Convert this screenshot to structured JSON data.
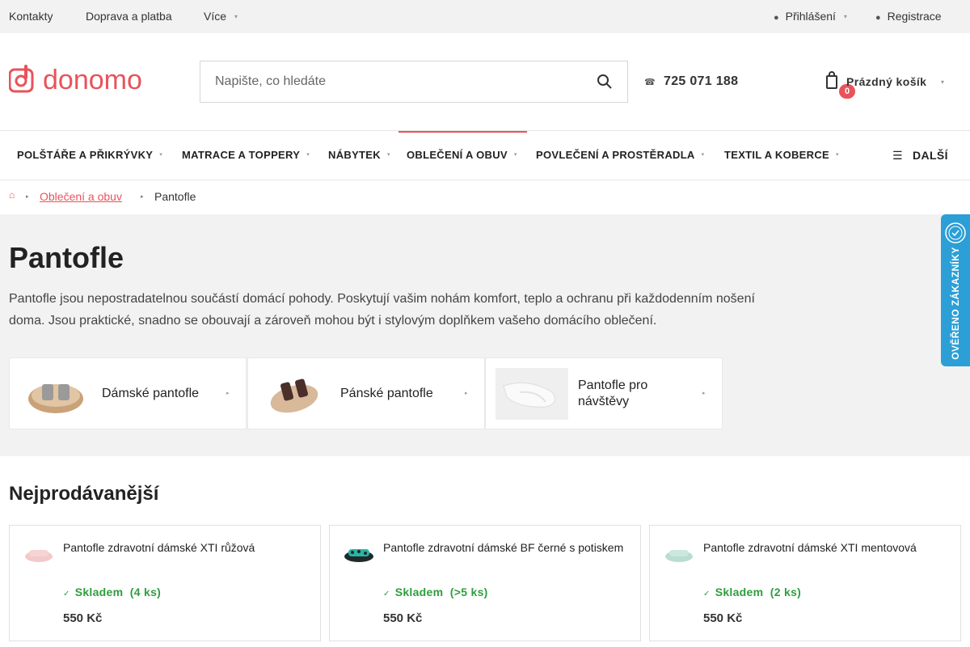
{
  "topbar": {
    "links": [
      "Kontakty",
      "Doprava a platba",
      "Více"
    ],
    "login": "Přihlášení",
    "register": "Registrace"
  },
  "header": {
    "logo_text": "donomo",
    "search_placeholder": "Napište, co hledáte",
    "phone": "725 071 188",
    "cart_label": "Prázdný košík",
    "cart_count": "0"
  },
  "nav": {
    "items": [
      "POLŠTÁŘE A PŘIKRÝVKY",
      "MATRACE A TOPPERY",
      "NÁBYTEK",
      "OBLEČENÍ A OBUV",
      "POVLEČENÍ A PROSTĚRADLA",
      "TEXTIL A KOBERCE"
    ],
    "active_index": 3,
    "more": "DALŠÍ"
  },
  "breadcrumb": {
    "parent": "Oblečení a obuv",
    "current": "Pantofle"
  },
  "category": {
    "title": "Pantofle",
    "description": "Pantofle jsou nepostradatelnou součástí domácí pohody. Poskytují vašim nohám komfort, teplo a ochranu při každodenním nošení doma. Jsou praktické, snadno se obouvají a zároveň mohou být i stylovým doplňkem vašeho domácího oblečení.",
    "subcategories": [
      {
        "name": "Dámské pantofle"
      },
      {
        "name": "Pánské pantofle"
      },
      {
        "name": "Pantofle pro návštěvy"
      }
    ]
  },
  "verified_badge": "OVĚŘENO ZÁKAZNÍKY",
  "bestsellers": {
    "title": "Nejprodávanější",
    "products": [
      {
        "title": "Pantofle zdravotní dámské XTI růžová",
        "stock_label": "Skladem",
        "stock_qty": "(4 ks)",
        "price": "550 Kč"
      },
      {
        "title": "Pantofle zdravotní dámské BF černé s potiskem",
        "stock_label": "Skladem",
        "stock_qty": "(>5 ks)",
        "price": "550 Kč"
      },
      {
        "title": "Pantofle zdravotní dámské XTI mentovová",
        "stock_label": "Skladem",
        "stock_qty": "(2 ks)",
        "price": "550 Kč"
      }
    ]
  },
  "colors": {
    "brand": "#e8535b",
    "stock_green": "#2e9e3e",
    "badge_blue": "#2b9fd6"
  }
}
